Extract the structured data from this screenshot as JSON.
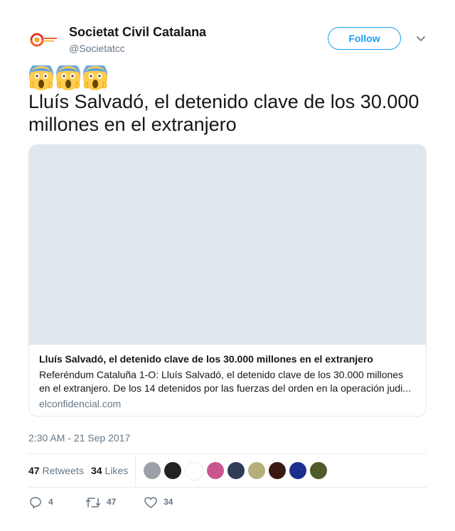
{
  "author": {
    "display_name": "Societat Civil Catalana",
    "handle": "@Societatcc",
    "avatar_icon": "scc-logo"
  },
  "follow_label": "Follow",
  "emojis": [
    "face-screaming-in-fear",
    "face-screaming-in-fear",
    "face-screaming-in-fear"
  ],
  "text": "Lluís Salvadó, el detenido clave de los 30.000 millones en el extranjero",
  "card": {
    "title": "Lluís Salvadó, el detenido clave de los 30.000 millones en el extranjero",
    "description": "Referéndum Cataluña 1-O: Lluís Salvadó, el detenido clave de los 30.000 millones en el extranjero. De los 14 detenidos por las fuerzas del orden en la operación judi...",
    "domain": "elconfidencial.com"
  },
  "timestamp": "2:30 AM - 21 Sep 2017",
  "stats": {
    "retweets_count": "47",
    "retweets_label": "Retweets",
    "likes_count": "34",
    "likes_label": "Likes"
  },
  "liker_avatars": [
    {
      "name": "liker-avatar-1",
      "color": "#9aa0a6"
    },
    {
      "name": "liker-avatar-2",
      "color": "#222222"
    },
    {
      "name": "liker-avatar-3",
      "color": "#ffffff"
    },
    {
      "name": "liker-avatar-4",
      "color": "#c9558f"
    },
    {
      "name": "liker-avatar-5",
      "color": "#2f3d57"
    },
    {
      "name": "liker-avatar-6",
      "color": "#b5b07a"
    },
    {
      "name": "liker-avatar-7",
      "color": "#3a1a12"
    },
    {
      "name": "liker-avatar-8",
      "color": "#1c2f8c"
    },
    {
      "name": "liker-avatar-9",
      "color": "#4f5a2a"
    }
  ],
  "actions": {
    "reply_count": "4",
    "retweet_count": "47",
    "like_count": "34"
  },
  "colors": {
    "accent": "#1da1f2",
    "secondary_text": "#657786",
    "border": "#e1e8ed"
  }
}
